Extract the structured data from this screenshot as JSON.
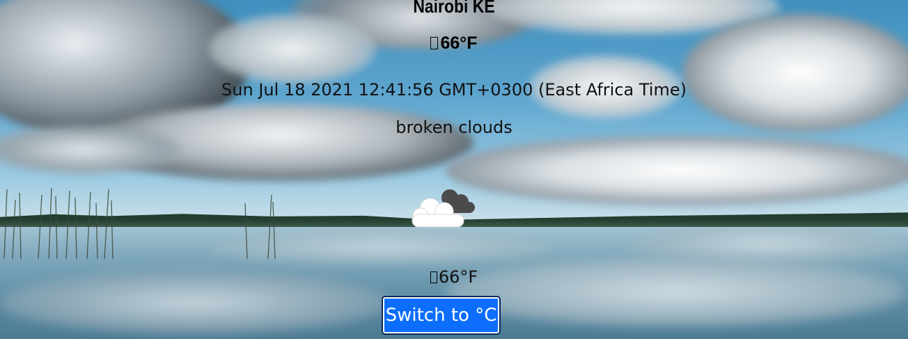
{
  "location": {
    "city": "Nairobi",
    "country": "KE"
  },
  "current": {
    "temperature_top": "66°F",
    "datetime": "Sun Jul 18 2021 12:41:56 GMT+0300 (East Africa Time)",
    "description": "broken clouds",
    "icon": "broken-clouds-icon",
    "temperature_bottom": "66°F"
  },
  "controls": {
    "switch_label": "Switch to °C"
  },
  "colors": {
    "button_bg": "#0d6efd",
    "button_text": "#ffffff",
    "text_primary": "#111111"
  },
  "background": {
    "description_icon": "lake-sky-landscape"
  }
}
